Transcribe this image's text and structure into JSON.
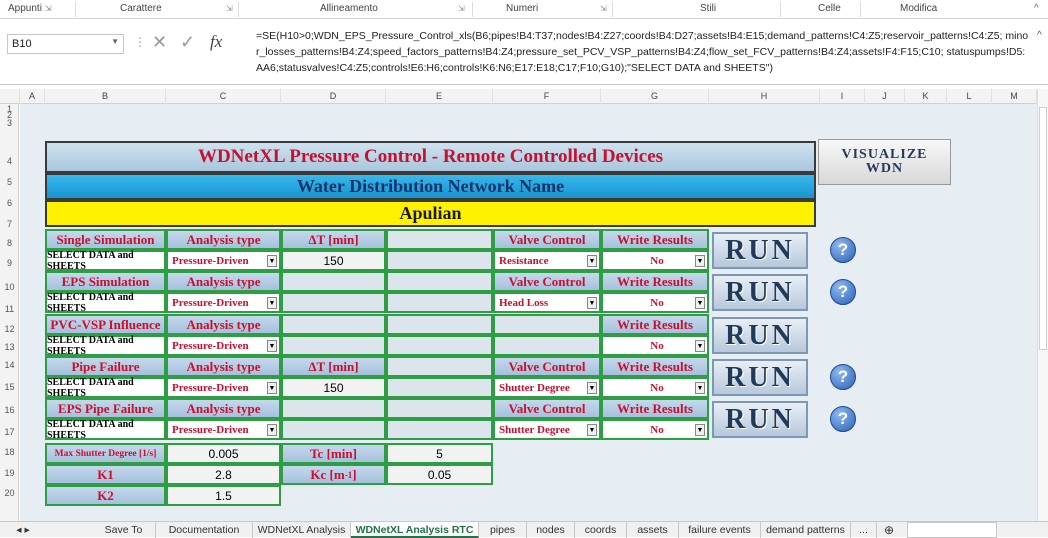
{
  "ribbon": {
    "groups": [
      {
        "label": "Appunti"
      },
      {
        "label": "Carattere"
      },
      {
        "label": "Allineamento"
      },
      {
        "label": "Numeri"
      },
      {
        "label": "Stili"
      },
      {
        "label": "Celle"
      },
      {
        "label": "Modifica"
      }
    ]
  },
  "formula_bar": {
    "name_box": "B10",
    "formula": "=SE(H10>0;WDN_EPS_Pressure_Control_xls(B6;pipes!B4:T37;nodes!B4:Z27;coords!B4:D27;assets!B4:E15;demand_patterns!C4:Z5;reservoir_patterns!C4:Z5; minor_losses_patterns!B4:Z4;speed_factors_patterns!B4:Z4;pressure_set_PCV_VSP_patterns!B4:Z4;flow_set_FCV_patterns!B4:Z4;assets!F4:F15;C10; statuspumps!D5:AA6;statusvalves!C4:Z5;controls!E6:H6;controls!K6:N6;E17:E18;C17;F10;G10);\"SELECT DATA and SHEETS\")"
  },
  "columns": [
    "A",
    "B",
    "C",
    "D",
    "E",
    "F",
    "G",
    "H",
    "I",
    "J",
    "K",
    "L",
    "M"
  ],
  "rows": [
    "1",
    "2",
    "3",
    "4",
    "5",
    "6",
    "7",
    "8",
    "9",
    "10",
    "11",
    "12",
    "13",
    "14",
    "15",
    "16",
    "17",
    "18",
    "19",
    "20"
  ],
  "main": {
    "title": "WDNetXL Pressure Control - Remote Controlled Devices",
    "network": "Water Distribution Network Name",
    "network_value": "Apulian",
    "visualize": [
      "VISUALIZE",
      "WDN"
    ],
    "run_label": "RUN",
    "help_label": "?",
    "blocks": [
      {
        "h": [
          "Single Simulation",
          "Analysis type",
          "ΔT [min]",
          "",
          "Valve Control",
          "Write Results"
        ],
        "v": [
          "SELECT DATA and SHEETS",
          "Pressure-Driven",
          "150",
          "",
          "Resistance",
          "No"
        ]
      },
      {
        "h": [
          "EPS Simulation",
          "Analysis type",
          "",
          "",
          "Valve Control",
          "Write Results"
        ],
        "v": [
          "SELECT DATA and SHEETS",
          "Pressure-Driven",
          "",
          "",
          "Head Loss",
          "No"
        ]
      },
      {
        "h": [
          "PVC-VSP Influence",
          "Analysis type",
          "",
          "",
          "",
          "Write Results"
        ],
        "v": [
          "SELECT DATA and SHEETS",
          "Pressure-Driven",
          "",
          "",
          "",
          "No"
        ]
      },
      {
        "h": [
          "Pipe Failure",
          "Analysis type",
          "ΔT [min]",
          "",
          "Valve Control",
          "Write Results"
        ],
        "v": [
          "SELECT DATA and SHEETS",
          "Pressure-Driven",
          "150",
          "",
          "Shutter Degree",
          "No"
        ]
      },
      {
        "h": [
          "EPS Pipe Failure",
          "Analysis type",
          "",
          "",
          "Valve Control",
          "Write Results"
        ],
        "v": [
          "SELECT DATA and SHEETS",
          "Pressure-Driven",
          "",
          "",
          "Shutter Degree",
          "No"
        ]
      }
    ],
    "params": [
      {
        "label": "Max Shutter Degree [1/s]",
        "value": "0.005",
        "label2": "Tc [min]",
        "value2": "5"
      },
      {
        "label": "K1",
        "value": "2.8",
        "label2": "Kc [m",
        "sup": "-1",
        "close": "]",
        "value2": "0.05"
      },
      {
        "label": "K2",
        "value": "1.5"
      }
    ]
  },
  "tabs": [
    "Save To",
    "Documentation",
    "WDNetXL Analysis",
    "WDNetXL Analysis RTC",
    "pipes",
    "nodes",
    "coords",
    "assets",
    "failure events",
    "demand patterns",
    "..."
  ],
  "colors": {
    "accent": "#217346",
    "header_text": "#c8102e",
    "border_green": "#2e9e45"
  }
}
